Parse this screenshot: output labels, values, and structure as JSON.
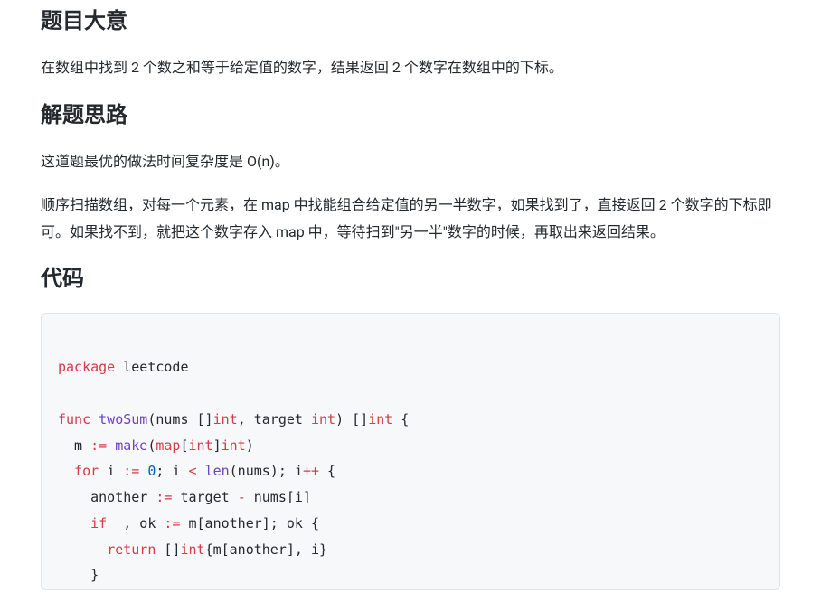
{
  "sections": {
    "meaning": {
      "title": "题目大意",
      "body": "在数组中找到 2 个数之和等于给定值的数字，结果返回 2 个数字在数组中的下标。"
    },
    "approach": {
      "title": "解题思路",
      "body1": "这道题最优的做法时间复杂度是 O(n)。",
      "body2": "顺序扫描数组，对每一个元素，在 map 中找能组合给定值的另一半数字，如果找到了，直接返回 2 个数字的下标即可。如果找不到，就把这个数字存入 map 中，等待扫到\"另一半\"数字的时候，再取出来返回结果。"
    },
    "code": {
      "title": "代码",
      "language": "go",
      "tokens": [
        [
          "\n",
          "plain"
        ],
        [
          "package",
          "kw"
        ],
        [
          " leetcode\n",
          "id"
        ],
        [
          "\n",
          "plain"
        ],
        [
          "func",
          "kw"
        ],
        [
          " ",
          "plain"
        ],
        [
          "twoSum",
          "fn"
        ],
        [
          "(nums []",
          "id"
        ],
        [
          "int",
          "type"
        ],
        [
          ", target ",
          "id"
        ],
        [
          "int",
          "type"
        ],
        [
          ") []",
          "id"
        ],
        [
          "int",
          "type"
        ],
        [
          " {\n",
          "id"
        ],
        [
          "  m ",
          "id"
        ],
        [
          ":=",
          "op"
        ],
        [
          " ",
          "plain"
        ],
        [
          "make",
          "fn"
        ],
        [
          "(",
          "id"
        ],
        [
          "map",
          "type"
        ],
        [
          "[",
          "id"
        ],
        [
          "int",
          "type"
        ],
        [
          "]",
          "id"
        ],
        [
          "int",
          "type"
        ],
        [
          ")\n",
          "id"
        ],
        [
          "  ",
          "plain"
        ],
        [
          "for",
          "kw"
        ],
        [
          " i ",
          "id"
        ],
        [
          ":=",
          "op"
        ],
        [
          " ",
          "plain"
        ],
        [
          "0",
          "num"
        ],
        [
          "; i ",
          "id"
        ],
        [
          "<",
          "op"
        ],
        [
          " ",
          "plain"
        ],
        [
          "len",
          "fn"
        ],
        [
          "(nums); i",
          "id"
        ],
        [
          "++",
          "op"
        ],
        [
          " {\n",
          "id"
        ],
        [
          "    another ",
          "id"
        ],
        [
          ":=",
          "op"
        ],
        [
          " target ",
          "id"
        ],
        [
          "-",
          "op"
        ],
        [
          " nums[i]\n",
          "id"
        ],
        [
          "    ",
          "plain"
        ],
        [
          "if",
          "kw"
        ],
        [
          " _, ok ",
          "id"
        ],
        [
          ":=",
          "op"
        ],
        [
          " m[another]; ok {\n",
          "id"
        ],
        [
          "      ",
          "plain"
        ],
        [
          "return",
          "kw"
        ],
        [
          " []",
          "id"
        ],
        [
          "int",
          "type"
        ],
        [
          "{m[another], i}\n",
          "id"
        ],
        [
          "    }\n",
          "id"
        ]
      ]
    }
  }
}
